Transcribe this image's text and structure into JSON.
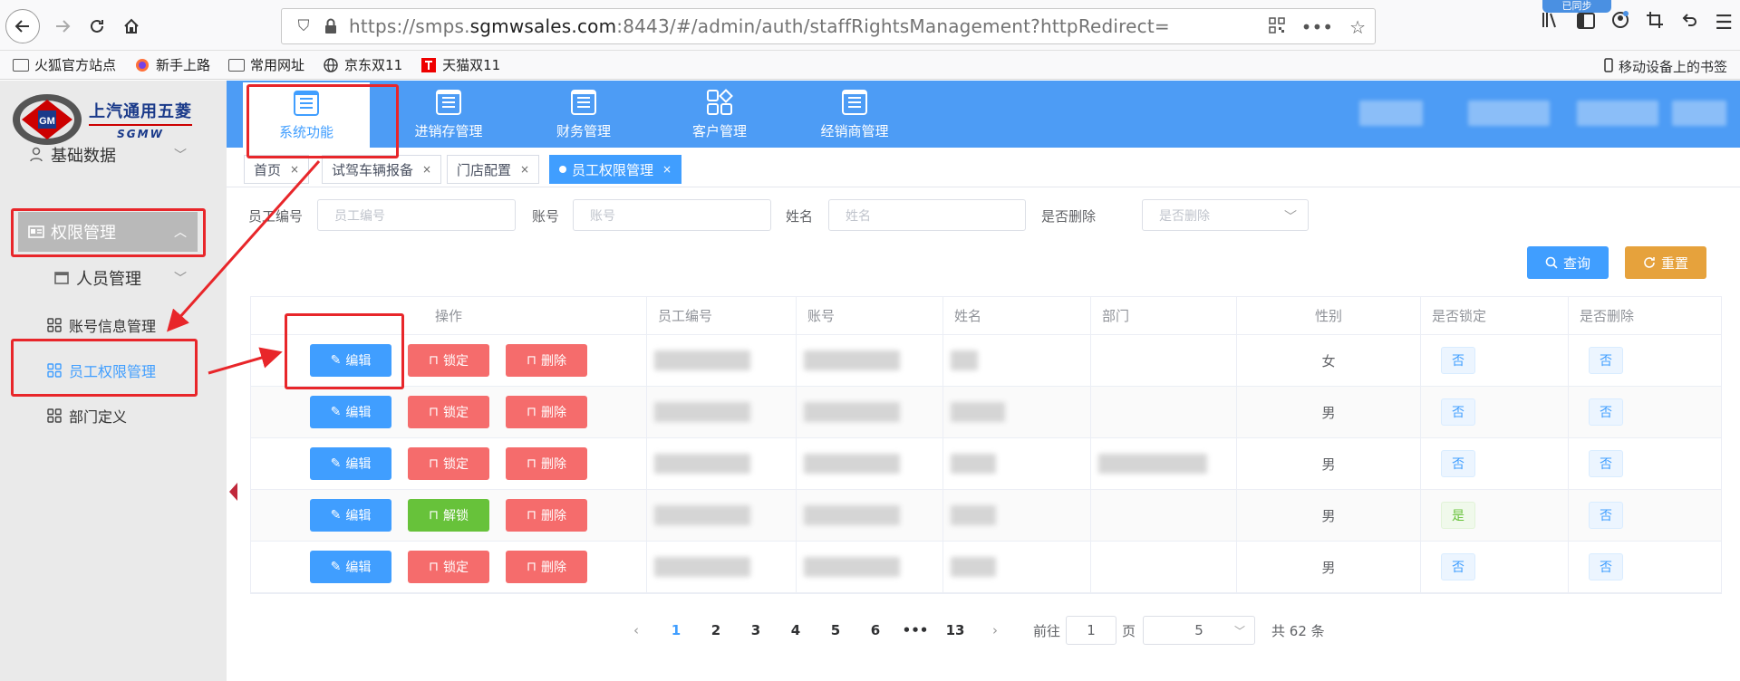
{
  "browser": {
    "url_prefix": "https://smps.",
    "url_host": "sgmwsales.com",
    "url_rest": ":8443/#/admin/auth/staffRightsManagement?httpRedirect=",
    "sync_label": "已同步"
  },
  "bookmarks": {
    "items": [
      "火狐官方站点",
      "新手上路",
      "常用网址",
      "京东双11",
      "天猫双11"
    ],
    "mobile": "移动设备上的书签"
  },
  "logo": {
    "cn": "上汽通用五菱",
    "en": "SGMW"
  },
  "sidebar": {
    "basic_data": "基础数据",
    "rights_mgmt": "权限管理",
    "personnel_mgmt": "人员管理",
    "account_info": "账号信息管理",
    "staff_rights": "员工权限管理",
    "dept_def": "部门定义"
  },
  "topnav": [
    "系统功能",
    "进销存管理",
    "财务管理",
    "客户管理",
    "经销商管理"
  ],
  "tabs": [
    "首页",
    "试驾车辆报备",
    "门店配置",
    "员工权限管理"
  ],
  "filters": {
    "staff_no_label": "员工编号",
    "staff_no_placeholder": "员工编号",
    "account_label": "账号",
    "account_placeholder": "账号",
    "name_label": "姓名",
    "name_placeholder": "姓名",
    "deleted_label": "是否删除",
    "deleted_placeholder": "是否删除",
    "query": "查询",
    "reset": "重置"
  },
  "table": {
    "headers": [
      "操作",
      "员工编号",
      "账号",
      "姓名",
      "部门",
      "性别",
      "是否锁定",
      "是否删除"
    ],
    "edit": "编辑",
    "lock": "锁定",
    "unlock": "解锁",
    "delete": "删除",
    "rows": [
      {
        "sex": "女",
        "locked": "否",
        "deleted": "否"
      },
      {
        "sex": "男",
        "locked": "否",
        "deleted": "否"
      },
      {
        "sex": "男",
        "locked": "否",
        "deleted": "否"
      },
      {
        "sex": "男",
        "locked": "是",
        "deleted": "否"
      },
      {
        "sex": "男",
        "locked": "否",
        "deleted": "否"
      }
    ]
  },
  "pager": {
    "pages": [
      "1",
      "2",
      "3",
      "4",
      "5",
      "6",
      "•••",
      "13"
    ],
    "goto": "前往",
    "page_input": "1",
    "page_unit": "页",
    "page_size": "5",
    "total": "共 62 条"
  }
}
